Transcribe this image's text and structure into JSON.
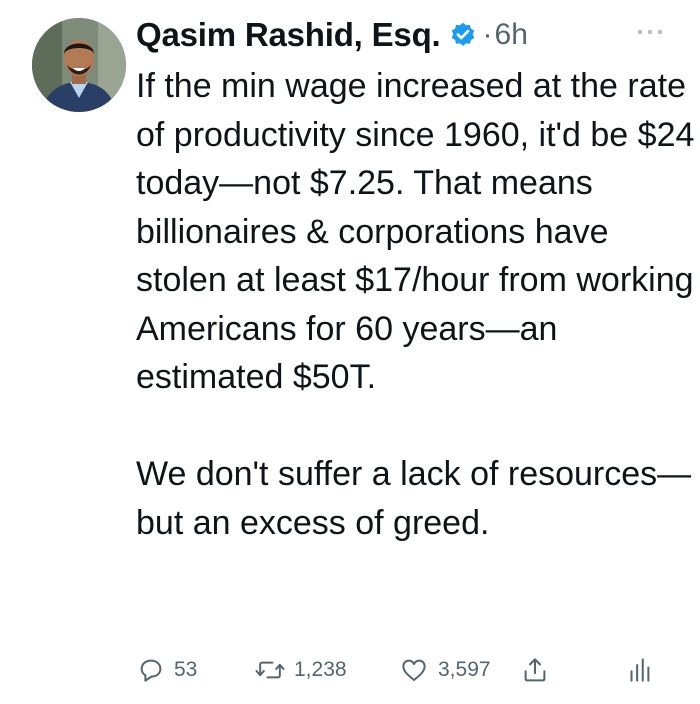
{
  "tweet": {
    "display_name": "Qasim Rashid, Esq.",
    "verified": true,
    "separator": "·",
    "time": "6h",
    "paragraphs": [
      "If the min wage increased at the rate of productivity since 1960, it'd be $24 today—not $7.25. That means billionaires & corporations have stolen at least $17/hour from working Americans for 60 years—an estimated $50T.",
      "We don't suffer a lack of resources—but an excess of greed."
    ]
  },
  "actions": {
    "replies": "53",
    "retweets": "1,238",
    "likes": "3,597"
  },
  "icons": {
    "avatar": "avatar-photo",
    "verified": "verified-badge-icon",
    "more": "more-icon",
    "reply": "reply-icon",
    "retweet": "retweet-icon",
    "like": "heart-icon",
    "share": "share-icon",
    "analytics": "analytics-icon"
  },
  "colors": {
    "text": "#0f1419",
    "secondary": "#536471",
    "verified": "#1d9bf0"
  }
}
